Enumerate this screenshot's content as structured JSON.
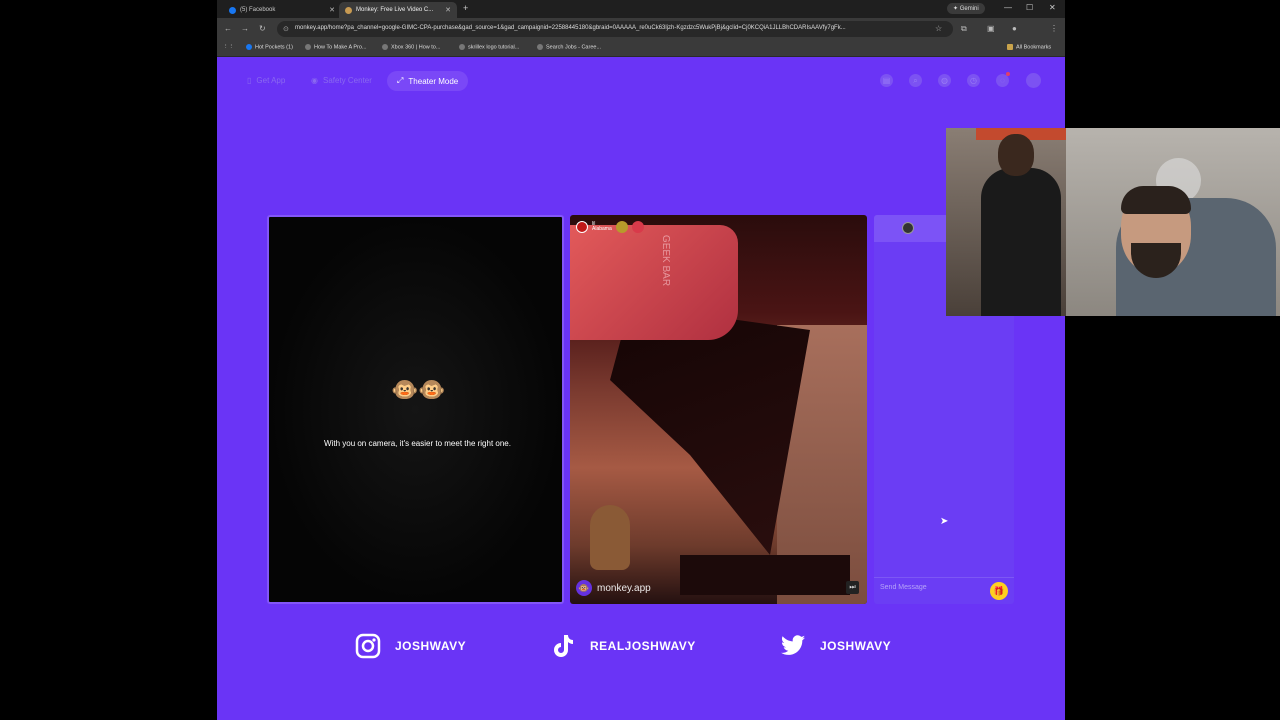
{
  "browser": {
    "tabs": [
      {
        "label": "(5) Facebook"
      },
      {
        "label": "Monkey: Free Live Video C..."
      }
    ],
    "gemini_label": "Gemini",
    "url": "monkey.app/home?pa_channel=google-GIMC-CPA-purchase&gad_source=1&gad_campaignid=22588445180&gbraid=0AAAAA_re0uCk63ljzh-Kgzdzc5WukPjBj&gclid=Cj0KCQiA1JLLBhCDARIsAAVfy7gFk...",
    "bookmarks": [
      "Hot Pockets (1)",
      "How To Make A Pro...",
      "Xbox 360 | How to...",
      "skrillex logo tutorial...",
      "Search Jobs - Caree..."
    ],
    "all_bookmarks": "All Bookmarks"
  },
  "site_nav": {
    "get_app": "Get App",
    "safety_center": "Safety Center",
    "theater_mode": "Theater Mode"
  },
  "left_panel": {
    "message": "With you on camera, it's easier to meet the right one.",
    "emoji": "🐵🐵"
  },
  "video": {
    "user_name": "lil",
    "user_location": "Alabama",
    "brand_text": "GEEK BAR",
    "watermark": "monkey.app"
  },
  "chat": {
    "placeholder": "Send Message"
  },
  "socials": [
    {
      "icon": "instagram-icon",
      "handle": "JOSHWAVY"
    },
    {
      "icon": "tiktok-icon",
      "handle": "REALJOSHWAVY"
    },
    {
      "icon": "twitter-icon",
      "handle": "JOSHWAVY"
    }
  ],
  "colors": {
    "brand_purple": "#6a34f6",
    "gift": "#ffcf1f"
  }
}
